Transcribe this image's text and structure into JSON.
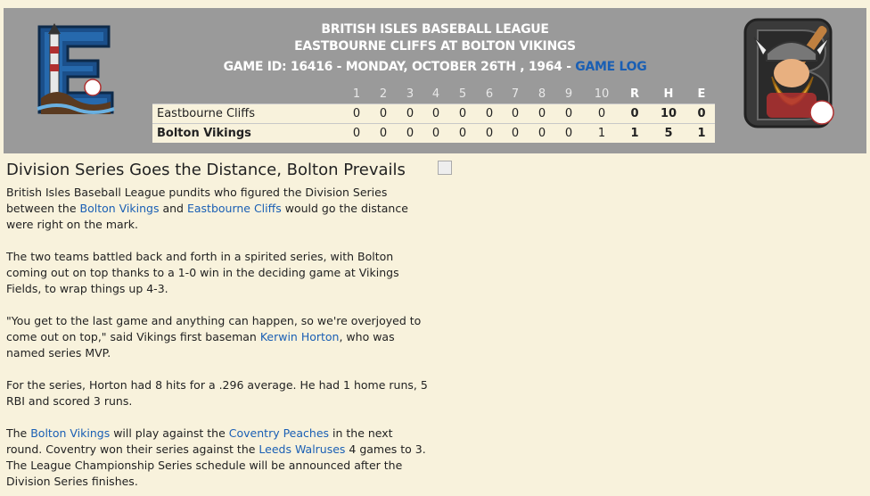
{
  "header": {
    "league": "BRITISH ISLES BASEBALL LEAGUE",
    "matchup": "EASTBOURNE CLIFFS AT BOLTON VIKINGS",
    "game_info": "GAME ID: 16416 - MONDAY, OCTOBER 26TH , 1964 - ",
    "game_log_link": "GAME LOG"
  },
  "boxscore": {
    "innings": [
      "1",
      "2",
      "3",
      "4",
      "5",
      "6",
      "7",
      "8",
      "9",
      "10"
    ],
    "rhe_headers": [
      "R",
      "H",
      "E"
    ],
    "rows": [
      {
        "team": "Eastbourne Cliffs",
        "innings": [
          "0",
          "0",
          "0",
          "0",
          "0",
          "0",
          "0",
          "0",
          "0",
          "0"
        ],
        "rhe": [
          "0",
          "10",
          "0"
        ]
      },
      {
        "team": "Bolton Vikings",
        "innings": [
          "0",
          "0",
          "0",
          "0",
          "0",
          "0",
          "0",
          "0",
          "0",
          "1"
        ],
        "rhe": [
          "1",
          "5",
          "1"
        ]
      }
    ]
  },
  "article": {
    "headline": "Division Series Goes the Distance, Bolton Prevails",
    "p1": {
      "a": "British Isles Baseball League pundits who figured the Division Series between the ",
      "link1": "Bolton Vikings",
      "b": " and ",
      "link2": "Eastbourne Cliffs",
      "c": " would go the distance were right on the mark."
    },
    "p2": "The two teams battled back and forth in a spirited series, with Bolton coming out on top thanks to a 1-0 win in the deciding game at Vikings Fields, to wrap things up 4-3.",
    "p3": {
      "a": "\"You get to the last game and anything can happen, so we're overjoyed to come out on top,\" said Vikings first baseman ",
      "link": "Kerwin Horton",
      "b": ", who was named series MVP."
    },
    "p4": "For the series, Horton had 8 hits for a .296 average. He had 1 home runs, 5 RBI and scored 3 runs.",
    "p5": {
      "a": "The ",
      "link1": "Bolton Vikings",
      "b": " will play against the ",
      "link2": "Coventry Peaches",
      "c": " in the next round. Coventry won their series against the ",
      "link3": "Leeds Walruses",
      "d": " 4 games to 3. The League Championship Series schedule will be announced after the Division Series finishes."
    }
  }
}
